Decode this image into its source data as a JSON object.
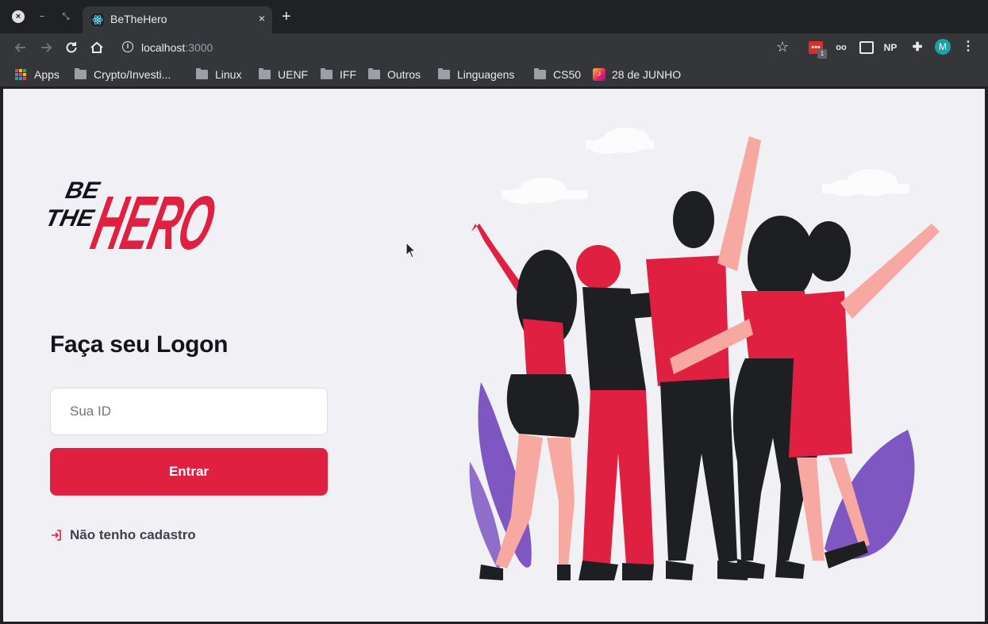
{
  "browser": {
    "tab": {
      "title": "BeTheHero",
      "close_glyph": "×"
    },
    "new_tab_glyph": "+",
    "window_controls": {
      "close": "×",
      "minimize": "−",
      "maximize": "⤡"
    },
    "url": {
      "host": "localhost",
      "port": ":3000"
    },
    "extensions": [
      {
        "name": "red-calendar-extension",
        "label": "•••",
        "badge": "1"
      },
      {
        "name": "glasses-extension",
        "label": "oo"
      },
      {
        "name": "picture-in-picture-extension",
        "label": ""
      },
      {
        "name": "np-extension",
        "label": "NP"
      },
      {
        "name": "puzzle-extensions-icon",
        "label": "✚"
      }
    ],
    "profile_initial": "M",
    "bookmarks": [
      {
        "label": "Apps",
        "type": "apps"
      },
      {
        "label": "Crypto/Investi...",
        "type": "folder"
      },
      {
        "label": "Linux",
        "type": "folder"
      },
      {
        "label": "UENF",
        "type": "folder"
      },
      {
        "label": "IFF",
        "type": "folder"
      },
      {
        "label": "Outros",
        "type": "folder"
      },
      {
        "label": "Linguagens",
        "type": "folder"
      },
      {
        "label": "CS50",
        "type": "folder"
      },
      {
        "label": "28 de JUNHO",
        "type": "music"
      }
    ]
  },
  "page": {
    "logo": {
      "line1": "BE",
      "line2": "THE",
      "line3": "HERO"
    },
    "logon_title": "Faça seu Logon",
    "id_input": {
      "placeholder": "Sua ID",
      "value": ""
    },
    "login_button": "Entrar",
    "register_link": "Não tenho cadastro"
  },
  "colors": {
    "brand_red": "#e02041",
    "page_bg": "#f0f0f5",
    "text_dark": "#13131a",
    "text_muted": "#41414d",
    "illustration_purple": "#7e57c2",
    "illustration_skin": "#f7a8a0",
    "illustration_black": "#1e1f23"
  }
}
